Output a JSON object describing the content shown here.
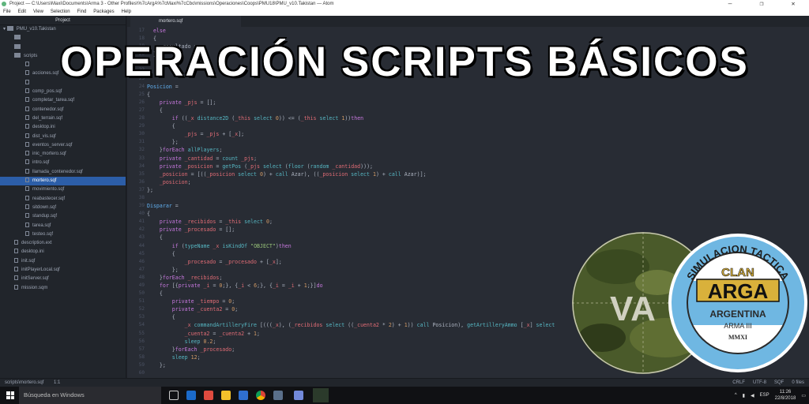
{
  "window": {
    "title": "Project — C:\\Users\\Maxi\\Documents\\Arma 3 - Other Profiles\\%7cArgA%7cMaxi%7cCbo\\missions\\Operaciones\\Coops\\PMU18\\PMU_v10.Takistan — Atom",
    "controls": [
      "—",
      "❐",
      "✕"
    ]
  },
  "menu": [
    "File",
    "Edit",
    "View",
    "Selection",
    "Find",
    "Packages",
    "Help"
  ],
  "tree": {
    "header": "Project",
    "root": "PMU_v10.Takistan",
    "items": [
      {
        "label": "",
        "type": "dir",
        "indent": 1
      },
      {
        "label": "",
        "type": "dir",
        "indent": 1
      },
      {
        "label": "scripts",
        "type": "dir",
        "indent": 1
      },
      {
        "label": "",
        "type": "file",
        "indent": 2
      },
      {
        "label": "acciones.sqf",
        "type": "file",
        "indent": 2
      },
      {
        "label": "",
        "type": "file",
        "indent": 2
      },
      {
        "label": "comp_pos.sqf",
        "type": "file",
        "indent": 2
      },
      {
        "label": "completar_tarea.sqf",
        "type": "file",
        "indent": 2
      },
      {
        "label": "contenedor.sqf",
        "type": "file",
        "indent": 2
      },
      {
        "label": "del_terrain.sqf",
        "type": "file",
        "indent": 2
      },
      {
        "label": "desktop.ini",
        "type": "file",
        "indent": 2
      },
      {
        "label": "dist_vis.sqf",
        "type": "file",
        "indent": 2
      },
      {
        "label": "eventos_server.sqf",
        "type": "file",
        "indent": 2
      },
      {
        "label": "inic_mortero.sqf",
        "type": "file",
        "indent": 2
      },
      {
        "label": "intro.sqf",
        "type": "file",
        "indent": 2
      },
      {
        "label": "llamada_contenedor.sqf",
        "type": "file",
        "indent": 2
      },
      {
        "label": "mortero.sqf",
        "type": "file",
        "indent": 2,
        "selected": true
      },
      {
        "label": "movimiento.sqf",
        "type": "file",
        "indent": 2
      },
      {
        "label": "reabastecer.sqf",
        "type": "file",
        "indent": 2
      },
      {
        "label": "sitdown.sqf",
        "type": "file",
        "indent": 2
      },
      {
        "label": "standup.sqf",
        "type": "file",
        "indent": 2
      },
      {
        "label": "tarea.sqf",
        "type": "file",
        "indent": 2
      },
      {
        "label": "testeo.sqf",
        "type": "file",
        "indent": 2
      },
      {
        "label": "description.ext",
        "type": "file",
        "indent": 1
      },
      {
        "label": "desktop.ini",
        "type": "file",
        "indent": 1
      },
      {
        "label": "init.sqf",
        "type": "file",
        "indent": 1
      },
      {
        "label": "initPlayerLocal.sqf",
        "type": "file",
        "indent": 1
      },
      {
        "label": "initServer.sqf",
        "type": "file",
        "indent": 1
      },
      {
        "label": "mission.sqm",
        "type": "file",
        "indent": 1
      }
    ]
  },
  "tab": {
    "label": "mortero.sqf"
  },
  "editor": {
    "lines": [
      {
        "n": "17",
        "html": "  <span class=\"kw\">else</span>"
      },
      {
        "n": "18",
        "html": "  {"
      },
      {
        "n": "19",
        "html": "    _resultado = "
      },
      {
        "n": "20",
        "html": "  };"
      },
      {
        "n": "21",
        "html": ""
      },
      {
        "n": "22",
        "html": ""
      },
      {
        "n": "23",
        "html": ""
      },
      {
        "n": "24",
        "html": "<span class=\"fn\">Posicion</span> ="
      },
      {
        "n": "25",
        "html": "{"
      },
      {
        "n": "26",
        "html": "    <span class=\"kw\">private</span> <span class=\"vr\">_pjs</span> = [];"
      },
      {
        "n": "27",
        "html": "    {"
      },
      {
        "n": "28",
        "html": "        <span class=\"kw\">if</span> ((<span class=\"vr\">_x</span> <span class=\"op\">distance2D</span> (<span class=\"vr\">_this</span> <span class=\"op\">select</span> <span class=\"nu\">0</span>)) &lt;= (<span class=\"vr\">_this</span> <span class=\"op\">select</span> <span class=\"nu\">1</span>))<span class=\"kw\">then</span>"
      },
      {
        "n": "29",
        "html": "        {"
      },
      {
        "n": "30",
        "html": "            <span class=\"vr\">_pjs</span> = <span class=\"vr\">_pjs</span> + [<span class=\"vr\">_x</span>];"
      },
      {
        "n": "31",
        "html": "        };"
      },
      {
        "n": "32",
        "html": "    }<span class=\"kw\">forEach</span> <span class=\"op\">allPlayers</span>;"
      },
      {
        "n": "33",
        "html": "    <span class=\"kw\">private</span> <span class=\"vr\">_cantidad</span> = <span class=\"op\">count</span> <span class=\"vr\">_pjs</span>;"
      },
      {
        "n": "34",
        "html": "    <span class=\"kw\">private</span> <span class=\"vr\">_posicion</span> = <span class=\"op\">getPos</span> (<span class=\"vr\">_pjs</span> <span class=\"op\">select</span> (<span class=\"op\">floor</span> (<span class=\"op\">random</span> <span class=\"vr\">_cantidad</span>)));"
      },
      {
        "n": "35",
        "html": "    <span class=\"vr\">_posicion</span> = [((<span class=\"vr\">_posicion</span> <span class=\"op\">select</span> <span class=\"nu\">0</span>) + <span class=\"op\">call</span> Azar), ((<span class=\"vr\">_posicion</span> <span class=\"op\">select</span> <span class=\"nu\">1</span>) + <span class=\"op\">call</span> Azar)];"
      },
      {
        "n": "36",
        "html": "    <span class=\"vr\">_posicion</span>;"
      },
      {
        "n": "37",
        "html": "};"
      },
      {
        "n": "38",
        "html": ""
      },
      {
        "n": "39",
        "html": "<span class=\"fn\">Disparar</span> ="
      },
      {
        "n": "40",
        "html": "{"
      },
      {
        "n": "41",
        "html": "    <span class=\"kw\">private</span> <span class=\"vr\">_recibidos</span> = <span class=\"vr\">_this</span> <span class=\"op\">select</span> <span class=\"nu\">0</span>;"
      },
      {
        "n": "42",
        "html": "    <span class=\"kw\">private</span> <span class=\"vr\">_procesado</span> = [];"
      },
      {
        "n": "43",
        "html": "    {"
      },
      {
        "n": "44",
        "html": "        <span class=\"kw\">if</span> (<span class=\"op\">typeName</span> <span class=\"vr\">_x</span> <span class=\"op\">isKindOf</span> <span class=\"st\">\"OBJECT\"</span>)<span class=\"kw\">then</span>"
      },
      {
        "n": "45",
        "html": "        {"
      },
      {
        "n": "46",
        "html": "            <span class=\"vr\">_procesado</span> = <span class=\"vr\">_procesado</span> + [<span class=\"vr\">_x</span>];"
      },
      {
        "n": "47",
        "html": "        };"
      },
      {
        "n": "48",
        "html": "    }<span class=\"kw\">forEach</span> <span class=\"vr\">_recibidos</span>;"
      },
      {
        "n": "49",
        "html": "    <span class=\"kw\">for</span> [{<span class=\"kw\">private</span> <span class=\"vr\">_i</span> = <span class=\"nu\">0</span>;}, {<span class=\"vr\">_i</span> &lt; <span class=\"nu\">6</span>;}, {<span class=\"vr\">_i</span> = <span class=\"vr\">_i</span> + <span class=\"nu\">1</span>;}]<span class=\"kw\">do</span>"
      },
      {
        "n": "50",
        "html": "    {"
      },
      {
        "n": "51",
        "html": "        <span class=\"kw\">private</span> <span class=\"vr\">_tiempo</span> = <span class=\"nu\">0</span>;"
      },
      {
        "n": "52",
        "html": "        <span class=\"kw\">private</span> <span class=\"vr\">_cuenta2</span> = <span class=\"nu\">0</span>;"
      },
      {
        "n": "53",
        "html": "        {"
      },
      {
        "n": "54",
        "html": "            <span class=\"vr\">_x</span> <span class=\"op\">commandArtilleryFire</span> [(((<span class=\"vr\">_x</span>), (<span class=\"vr\">_recibidos</span> <span class=\"op\">select</span> ((<span class=\"vr\">_cuenta2</span> * <span class=\"nu\">2</span>) + <span class=\"nu\">1</span>)) <span class=\"op\">call</span> Posicion), <span class=\"op\">getArtilleryAmmo</span> [<span class=\"vr\">_x</span>] <span class=\"op\">select</span>"
      },
      {
        "n": "55",
        "html": "            <span class=\"vr\">_cuenta2</span> = <span class=\"vr\">_cuenta2</span> + <span class=\"nu\">1</span>;"
      },
      {
        "n": "56",
        "html": "            <span class=\"op\">sleep</span> <span class=\"nu\">0.2</span>;"
      },
      {
        "n": "57",
        "html": "        }<span class=\"kw\">forEach</span> <span class=\"vr\">_procesado</span>;"
      },
      {
        "n": "58",
        "html": "        <span class=\"op\">sleep</span> <span class=\"nu\">12</span>;"
      },
      {
        "n": "59",
        "html": "    };"
      },
      {
        "n": "60",
        "html": ""
      },
      {
        "n": "61",
        "html": "    _lista = [];"
      }
    ]
  },
  "status": {
    "path": "scripts\\mortero.sqf",
    "position": "1:1",
    "right": [
      "CRLF",
      "UTF-8",
      "SQF",
      "0 files"
    ]
  },
  "taskbar": {
    "search_placeholder": "Búsqueda en Windows",
    "language": "ESP",
    "time": "11:26",
    "date": "22/8/2018"
  },
  "overlay": {
    "headline": "OPERACIÓN SCRIPTS BÁSICOS",
    "badge_top": "SIMULACION TACTICA",
    "badge_clan": "CLAN",
    "badge_name": "ARGA",
    "badge_country": "ARGENTINA",
    "badge_game": "ARMA III",
    "badge_year": "MMXI",
    "left_logo_text": "VA"
  },
  "colors": {
    "editor_bg": "#282c34",
    "sidebar_bg": "#21252b",
    "selection": "#2c5ea8",
    "badge_blue": "#6fb7e2",
    "badge_gold": "#d9b13b",
    "camo_green": "#4a5a2a"
  }
}
